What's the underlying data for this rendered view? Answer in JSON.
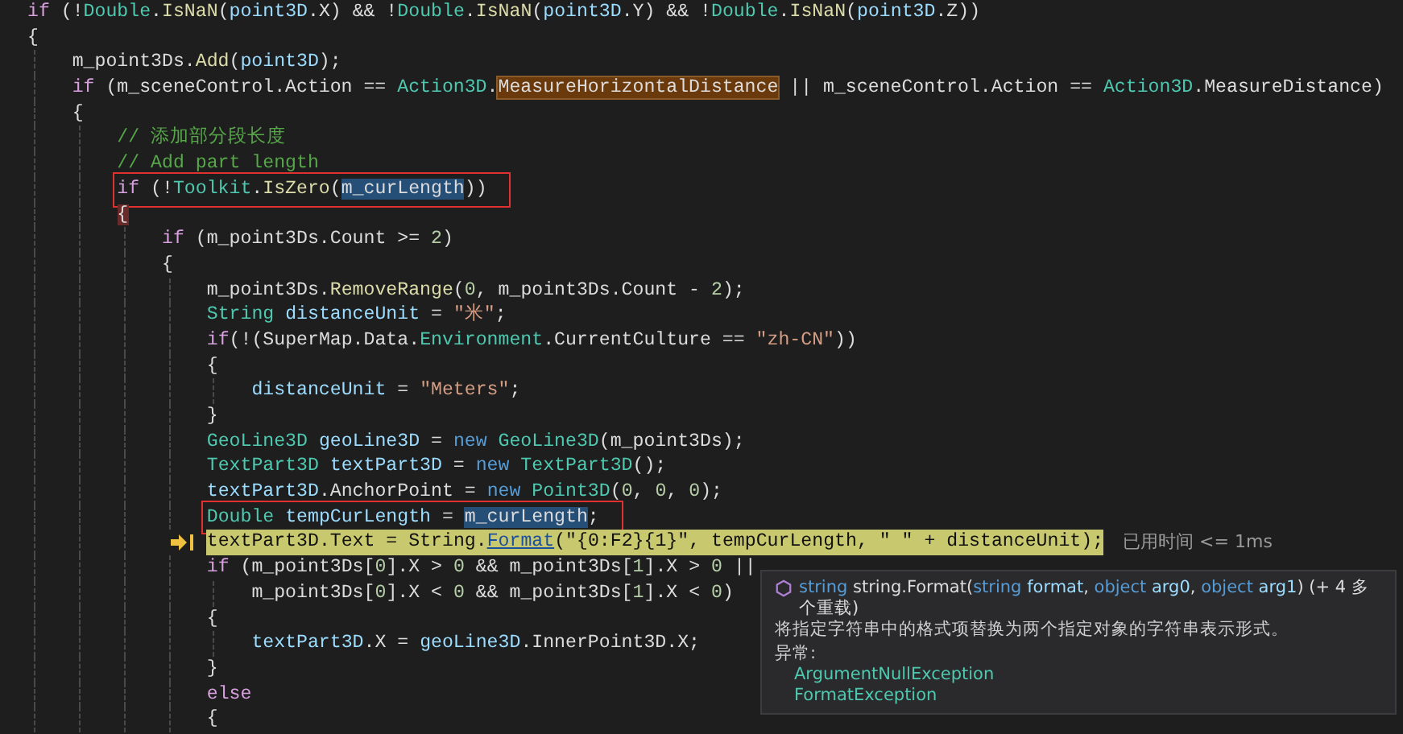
{
  "code_lines": [
    {
      "boxed": false,
      "current": false,
      "tokens": [
        {
          "kind": "control",
          "text": "if"
        },
        {
          "kind": "plain",
          "text": " (!"
        },
        {
          "kind": "type",
          "text": "Double"
        },
        {
          "kind": "plain",
          "text": "."
        },
        {
          "kind": "method",
          "text": "IsNaN"
        },
        {
          "kind": "plain",
          "text": "("
        },
        {
          "kind": "variable",
          "text": "point3D"
        },
        {
          "kind": "plain",
          "text": ".X) && !"
        },
        {
          "kind": "type",
          "text": "Double"
        },
        {
          "kind": "plain",
          "text": "."
        },
        {
          "kind": "method",
          "text": "IsNaN"
        },
        {
          "kind": "plain",
          "text": "("
        },
        {
          "kind": "variable",
          "text": "point3D"
        },
        {
          "kind": "plain",
          "text": ".Y) && !"
        },
        {
          "kind": "type",
          "text": "Double"
        },
        {
          "kind": "plain",
          "text": "."
        },
        {
          "kind": "method",
          "text": "IsNaN"
        },
        {
          "kind": "plain",
          "text": "("
        },
        {
          "kind": "variable",
          "text": "point3D"
        },
        {
          "kind": "plain",
          "text": ".Z))"
        }
      ]
    },
    {
      "boxed": false,
      "current": false,
      "tokens": [
        {
          "kind": "plain",
          "text": "{"
        }
      ],
      "children": [
        {
          "boxed": false,
          "current": false,
          "tokens": [
            {
              "kind": "plain",
              "text": "m_point3Ds."
            },
            {
              "kind": "method",
              "text": "Add"
            },
            {
              "kind": "plain",
              "text": "("
            },
            {
              "kind": "variable",
              "text": "point3D"
            },
            {
              "kind": "plain",
              "text": ");"
            }
          ]
        },
        {
          "boxed": false,
          "current": false,
          "tokens": [
            {
              "kind": "control",
              "text": "if"
            },
            {
              "kind": "plain",
              "text": " (m_sceneControl.Action == "
            },
            {
              "kind": "type",
              "text": "Action3D"
            },
            {
              "kind": "plain",
              "text": "."
            },
            {
              "kind": "reference_highlight",
              "text": "MeasureHorizontalDistance"
            },
            {
              "kind": "plain",
              "text": " || m_sceneControl.Action == "
            },
            {
              "kind": "type",
              "text": "Action3D"
            },
            {
              "kind": "plain",
              "text": ".MeasureDistance)"
            }
          ]
        },
        {
          "boxed": false,
          "current": false,
          "tokens": [
            {
              "kind": "plain",
              "text": "{"
            }
          ],
          "children": [
            {
              "boxed": false,
              "current": false,
              "tokens": [
                {
                  "kind": "comment",
                  "text": "// 添加部分段长度"
                }
              ]
            },
            {
              "boxed": false,
              "current": false,
              "tokens": [
                {
                  "kind": "comment",
                  "text": "// Add part length"
                }
              ]
            },
            {
              "boxed": true,
              "current": false,
              "tokens": [
                {
                  "kind": "control",
                  "text": "if"
                },
                {
                  "kind": "plain",
                  "text": " (!"
                },
                {
                  "kind": "type",
                  "text": "Toolkit"
                },
                {
                  "kind": "plain",
                  "text": "."
                },
                {
                  "kind": "method",
                  "text": "IsZero"
                },
                {
                  "kind": "plain",
                  "text": "("
                },
                {
                  "kind": "selection",
                  "text": "m_curLength"
                },
                {
                  "kind": "plain",
                  "text": "))"
                }
              ]
            },
            {
              "boxed": false,
              "current": false,
              "tokens": [
                {
                  "kind": "brace_match",
                  "text": "{"
                }
              ],
              "children": [
                {
                  "boxed": false,
                  "current": false,
                  "tokens": [
                    {
                      "kind": "control",
                      "text": "if"
                    },
                    {
                      "kind": "plain",
                      "text": " (m_point3Ds.Count >= "
                    },
                    {
                      "kind": "number",
                      "text": "2"
                    },
                    {
                      "kind": "plain",
                      "text": ")"
                    }
                  ]
                },
                {
                  "boxed": false,
                  "current": false,
                  "tokens": [
                    {
                      "kind": "plain",
                      "text": "{"
                    }
                  ],
                  "children": [
                    {
                      "boxed": false,
                      "current": false,
                      "tokens": [
                        {
                          "kind": "plain",
                          "text": "m_point3Ds."
                        },
                        {
                          "kind": "method",
                          "text": "RemoveRange"
                        },
                        {
                          "kind": "plain",
                          "text": "("
                        },
                        {
                          "kind": "number",
                          "text": "0"
                        },
                        {
                          "kind": "plain",
                          "text": ", m_point3Ds.Count - "
                        },
                        {
                          "kind": "number",
                          "text": "2"
                        },
                        {
                          "kind": "plain",
                          "text": ");"
                        }
                      ]
                    },
                    {
                      "boxed": false,
                      "current": false,
                      "tokens": [
                        {
                          "kind": "type",
                          "text": "String"
                        },
                        {
                          "kind": "variable",
                          "text": " distanceUnit"
                        },
                        {
                          "kind": "plain",
                          "text": " = "
                        },
                        {
                          "kind": "string",
                          "text": "\"米\""
                        },
                        {
                          "kind": "plain",
                          "text": ";"
                        }
                      ]
                    },
                    {
                      "boxed": false,
                      "current": false,
                      "tokens": [
                        {
                          "kind": "control",
                          "text": "if"
                        },
                        {
                          "kind": "plain",
                          "text": "(!(SuperMap.Data."
                        },
                        {
                          "kind": "type",
                          "text": "Environment"
                        },
                        {
                          "kind": "plain",
                          "text": ".CurrentCulture == "
                        },
                        {
                          "kind": "string",
                          "text": "\"zh-CN\""
                        },
                        {
                          "kind": "plain",
                          "text": "))"
                        }
                      ]
                    },
                    {
                      "boxed": false,
                      "current": false,
                      "tokens": [
                        {
                          "kind": "plain",
                          "text": "{"
                        }
                      ],
                      "children": [
                        {
                          "boxed": false,
                          "current": false,
                          "tokens": [
                            {
                              "kind": "variable",
                              "text": "distanceUnit"
                            },
                            {
                              "kind": "plain",
                              "text": " = "
                            },
                            {
                              "kind": "string",
                              "text": "\"Meters\""
                            },
                            {
                              "kind": "plain",
                              "text": ";"
                            }
                          ]
                        }
                      ]
                    },
                    {
                      "boxed": false,
                      "current": false,
                      "tokens": [
                        {
                          "kind": "plain",
                          "text": "}"
                        }
                      ]
                    },
                    {
                      "boxed": false,
                      "current": false,
                      "tokens": [
                        {
                          "kind": "type",
                          "text": "GeoLine3D"
                        },
                        {
                          "kind": "variable",
                          "text": " geoLine3D"
                        },
                        {
                          "kind": "plain",
                          "text": " = "
                        },
                        {
                          "kind": "keyword",
                          "text": "new"
                        },
                        {
                          "kind": "type",
                          "text": " GeoLine3D"
                        },
                        {
                          "kind": "plain",
                          "text": "(m_point3Ds);"
                        }
                      ]
                    },
                    {
                      "boxed": false,
                      "current": false,
                      "tokens": [
                        {
                          "kind": "type",
                          "text": "TextPart3D"
                        },
                        {
                          "kind": "variable",
                          "text": " textPart3D"
                        },
                        {
                          "kind": "plain",
                          "text": " = "
                        },
                        {
                          "kind": "keyword",
                          "text": "new"
                        },
                        {
                          "kind": "type",
                          "text": " TextPart3D"
                        },
                        {
                          "kind": "plain",
                          "text": "();"
                        }
                      ]
                    },
                    {
                      "boxed": false,
                      "current": false,
                      "tokens": [
                        {
                          "kind": "variable",
                          "text": "textPart3D"
                        },
                        {
                          "kind": "plain",
                          "text": ".AnchorPoint = "
                        },
                        {
                          "kind": "keyword",
                          "text": "new"
                        },
                        {
                          "kind": "type",
                          "text": " Point3D"
                        },
                        {
                          "kind": "plain",
                          "text": "("
                        },
                        {
                          "kind": "number",
                          "text": "0"
                        },
                        {
                          "kind": "plain",
                          "text": ", "
                        },
                        {
                          "kind": "number",
                          "text": "0"
                        },
                        {
                          "kind": "plain",
                          "text": ", "
                        },
                        {
                          "kind": "number",
                          "text": "0"
                        },
                        {
                          "kind": "plain",
                          "text": ");"
                        }
                      ]
                    },
                    {
                      "boxed": true,
                      "current": false,
                      "tokens": [
                        {
                          "kind": "type",
                          "text": "Double"
                        },
                        {
                          "kind": "variable",
                          "text": " tempCurLength"
                        },
                        {
                          "kind": "plain",
                          "text": " = "
                        },
                        {
                          "kind": "selection",
                          "text": "m_curLength"
                        },
                        {
                          "kind": "plain",
                          "text": ";"
                        }
                      ]
                    },
                    {
                      "boxed": false,
                      "current": true,
                      "elapsed": "已用时间 <= 1ms",
                      "tokens": [
                        {
                          "kind": "variable",
                          "text": "textPart3D"
                        },
                        {
                          "kind": "plain",
                          "text": ".Text = "
                        },
                        {
                          "kind": "type",
                          "text": "String"
                        },
                        {
                          "kind": "plain",
                          "text": "."
                        },
                        {
                          "kind": "method",
                          "text": "Format"
                        },
                        {
                          "kind": "plain",
                          "text": "("
                        },
                        {
                          "kind": "string",
                          "text": "\"{0:F2}{1}\""
                        },
                        {
                          "kind": "plain",
                          "text": ", "
                        },
                        {
                          "kind": "variable",
                          "text": "tempCurLength"
                        },
                        {
                          "kind": "plain",
                          "text": ", "
                        },
                        {
                          "kind": "string",
                          "text": "\" \""
                        },
                        {
                          "kind": "plain",
                          "text": " + "
                        },
                        {
                          "kind": "variable",
                          "text": "distanceUnit"
                        },
                        {
                          "kind": "plain",
                          "text": ");"
                        }
                      ]
                    },
                    {
                      "boxed": false,
                      "current": false,
                      "tokens": [
                        {
                          "kind": "control",
                          "text": "if"
                        },
                        {
                          "kind": "plain",
                          "text": " (m_point3Ds["
                        },
                        {
                          "kind": "number",
                          "text": "0"
                        },
                        {
                          "kind": "plain",
                          "text": "].X > "
                        },
                        {
                          "kind": "number",
                          "text": "0"
                        },
                        {
                          "kind": "plain",
                          "text": " && m_point3Ds["
                        },
                        {
                          "kind": "number",
                          "text": "1"
                        },
                        {
                          "kind": "plain",
                          "text": "].X > "
                        },
                        {
                          "kind": "number",
                          "text": "0"
                        },
                        {
                          "kind": "plain",
                          "text": " ||"
                        }
                      ],
                      "children": [
                        {
                          "boxed": false,
                          "current": false,
                          "tokens": [
                            {
                              "kind": "plain",
                              "text": "m_point3Ds["
                            },
                            {
                              "kind": "number",
                              "text": "0"
                            },
                            {
                              "kind": "plain",
                              "text": "].X < "
                            },
                            {
                              "kind": "number",
                              "text": "0"
                            },
                            {
                              "kind": "plain",
                              "text": " && m_point3Ds["
                            },
                            {
                              "kind": "number",
                              "text": "1"
                            },
                            {
                              "kind": "plain",
                              "text": "].X < "
                            },
                            {
                              "kind": "number",
                              "text": "0"
                            },
                            {
                              "kind": "plain",
                              "text": ")"
                            }
                          ]
                        }
                      ]
                    },
                    {
                      "boxed": false,
                      "current": false,
                      "tokens": [
                        {
                          "kind": "plain",
                          "text": "{"
                        }
                      ],
                      "children": [
                        {
                          "boxed": false,
                          "current": false,
                          "tokens": [
                            {
                              "kind": "variable",
                              "text": "textPart3D"
                            },
                            {
                              "kind": "plain",
                              "text": ".X = "
                            },
                            {
                              "kind": "variable",
                              "text": "geoLine3D"
                            },
                            {
                              "kind": "plain",
                              "text": ".InnerPoint3D.X;"
                            }
                          ]
                        }
                      ]
                    },
                    {
                      "boxed": false,
                      "current": false,
                      "tokens": [
                        {
                          "kind": "plain",
                          "text": "}"
                        }
                      ]
                    },
                    {
                      "boxed": false,
                      "current": false,
                      "tokens": [
                        {
                          "kind": "control",
                          "text": "else"
                        }
                      ]
                    },
                    {
                      "boxed": false,
                      "current": false,
                      "tokens": [
                        {
                          "kind": "plain",
                          "text": "{"
                        }
                      ]
                    }
                  ]
                }
              ]
            }
          ]
        }
      ]
    }
  ],
  "quick_info": {
    "signature": [
      {
        "kind": "keyword",
        "text": "string"
      },
      {
        "kind": "plain",
        "text": " string.Format("
      },
      {
        "kind": "keyword",
        "text": "string"
      },
      {
        "kind": "param",
        "text": " format"
      },
      {
        "kind": "plain",
        "text": ", "
      },
      {
        "kind": "keyword",
        "text": "object"
      },
      {
        "kind": "param",
        "text": " arg0"
      },
      {
        "kind": "plain",
        "text": ", "
      },
      {
        "kind": "keyword",
        "text": "object"
      },
      {
        "kind": "param",
        "text": " arg1"
      },
      {
        "kind": "plain",
        "text": ") (+ 4 多个重载)"
      }
    ],
    "description": "将指定字符串中的格式项替换为两个指定对象的字符串表示形式。",
    "exceptions_heading": "异常:",
    "exceptions": [
      "ArgumentNullException",
      "FormatException"
    ]
  }
}
